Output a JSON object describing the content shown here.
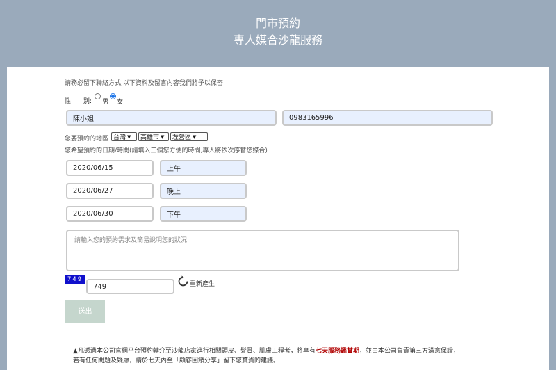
{
  "header": {
    "title": "門市預約",
    "subtitle": "專人媒合沙龍服務"
  },
  "form": {
    "notice": "請務必留下聯絡方式,以下資料及留言內容我們將予以保密",
    "gender_label": "性　　別:",
    "gender_options": [
      "男",
      "女"
    ],
    "gender_selected": "女",
    "name_value": "陳小姐",
    "phone_value": "0983165996",
    "region_label": "您要預約的地區",
    "region_selects": [
      "台灣",
      "高雄市",
      "左營區"
    ],
    "date_label": "您希望預約的日期/時間(請填入三個您方便的時間,專人將依次序替您媒合)",
    "appointments": [
      {
        "date": "2020/06/15",
        "time": "上午"
      },
      {
        "date": "2020/06/27",
        "time": "晚上"
      },
      {
        "date": "2020/06/30",
        "time": "下午"
      }
    ],
    "message_placeholder": "請輸入您的預約需求及簡易說明您的狀況",
    "captcha_code": "749",
    "captcha_value": "749",
    "regenerate_label": "重新產生",
    "submit_label": "送出"
  },
  "footer": {
    "line1_before": "▲凡透過本公司官網平台預約轉介至沙龍店家進行相關頭皮、髮質、肌膚工程者，將享有",
    "line1_highlight": "七天服務鑑賞期",
    "line1_after": "，並由本公司負責第三方滿意保證，",
    "line2": "若有任何問題及疑慮，請於七天內至「顧客回饋分享」留下您寶貴的建議。"
  },
  "colors": {
    "header_bg": "#9aaabb",
    "input_autofill": "#e8f0fe",
    "captcha_bg": "#1010cc",
    "submit_bg": "#c5d6cd",
    "highlight": "#b00000"
  }
}
